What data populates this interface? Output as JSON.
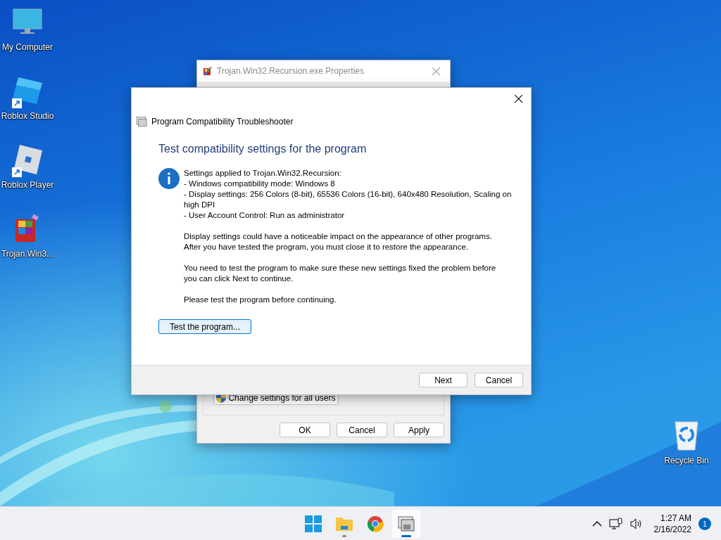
{
  "desktop_icons": [
    {
      "label": "My Computer",
      "kind": "computer",
      "shortcut": false
    },
    {
      "label": "Roblox Studio",
      "kind": "studio",
      "shortcut": true
    },
    {
      "label": "Roblox Player",
      "kind": "player",
      "shortcut": true
    },
    {
      "label": "Trojan.Win3...",
      "kind": "archive",
      "shortcut": false
    }
  ],
  "recycle_bin": {
    "label": "Recycle Bin"
  },
  "properties_window": {
    "title": "Trojan.Win32.Recursion.exe Properties",
    "change_settings_button": "Change settings for all users",
    "buttons": [
      "OK",
      "Cancel",
      "Apply"
    ]
  },
  "dialog": {
    "title": "Program Compatibility Troubleshooter",
    "heading": "Test compatibility settings for the program",
    "blocks": [
      {
        "lines": [
          "Settings applied to Trojan.Win32.Recursion:",
          "- Windows compatibility mode: Windows 8",
          "- Display settings:  256 Colors (8-bit), 65536 Colors (16-bit), 640x480 Resolution, Scaling on",
          "high DPI",
          "- User Account Control:  Run as administrator"
        ]
      },
      {
        "lines": [
          "Display settings could have a noticeable impact on the appearance of other programs.",
          "After you have tested the program, you must close it to restore the appearance."
        ]
      },
      {
        "lines": [
          "You need to test the program to make sure these new settings fixed the problem before",
          "you can click Next to continue."
        ]
      },
      {
        "lines": [
          "Please test the program before continuing."
        ]
      }
    ],
    "test_button": "Test the program...",
    "buttons": [
      "Next",
      "Cancel"
    ]
  },
  "taskbar": {
    "apps": [
      {
        "kind": "start",
        "selected": false,
        "running": false
      },
      {
        "kind": "explorer",
        "selected": false,
        "running": true
      },
      {
        "kind": "chrome",
        "selected": false,
        "running": false
      },
      {
        "kind": "troubleshooter",
        "selected": true,
        "running": true
      }
    ],
    "time": "1:27 AM",
    "date": "2/16/2022",
    "notifications": "1"
  }
}
